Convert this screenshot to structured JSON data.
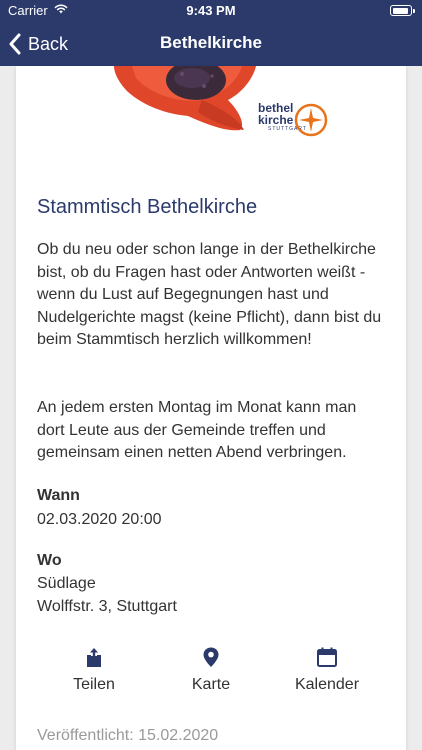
{
  "status_bar": {
    "carrier": "Carrier",
    "time": "9:43 PM",
    "battery_level": 0.9
  },
  "nav": {
    "back_label": "Back",
    "title": "Bethelkirche"
  },
  "logo": {
    "line1": "bethel",
    "line2": "kirche",
    "line3": "STUTTGART",
    "accent": "#e8731a"
  },
  "event": {
    "title": "Stammtisch Bethelkirche",
    "description": "Ob du neu oder schon lange in der Bethelkirche bist, ob du Fragen hast oder Antworten weißt - wenn du Lust auf Begegnungen hast und Nudelgerichte magst (keine Pflicht), dann bist du beim Stammtisch herzlich willkommen!",
    "description2": "An jedem ersten Montag im Monat kann man dort Leute aus der Gemeinde treffen und gemeinsam einen netten Abend verbringen.",
    "when_label": "Wann",
    "when_value": "02.03.2020 20:00",
    "where_label": "Wo",
    "where_line1": "Südlage",
    "where_line2": "Wolffstr. 3, Stuttgart",
    "published": "Veröffentlicht: 15.02.2020"
  },
  "actions": [
    {
      "label": "Teilen",
      "icon": "share-icon"
    },
    {
      "label": "Karte",
      "icon": "map-pin-icon"
    },
    {
      "label": "Kalender",
      "icon": "calendar-icon"
    }
  ],
  "colors": {
    "navy": "#2b3a6b",
    "poppy": "#e0462a",
    "background": "#ececec"
  }
}
